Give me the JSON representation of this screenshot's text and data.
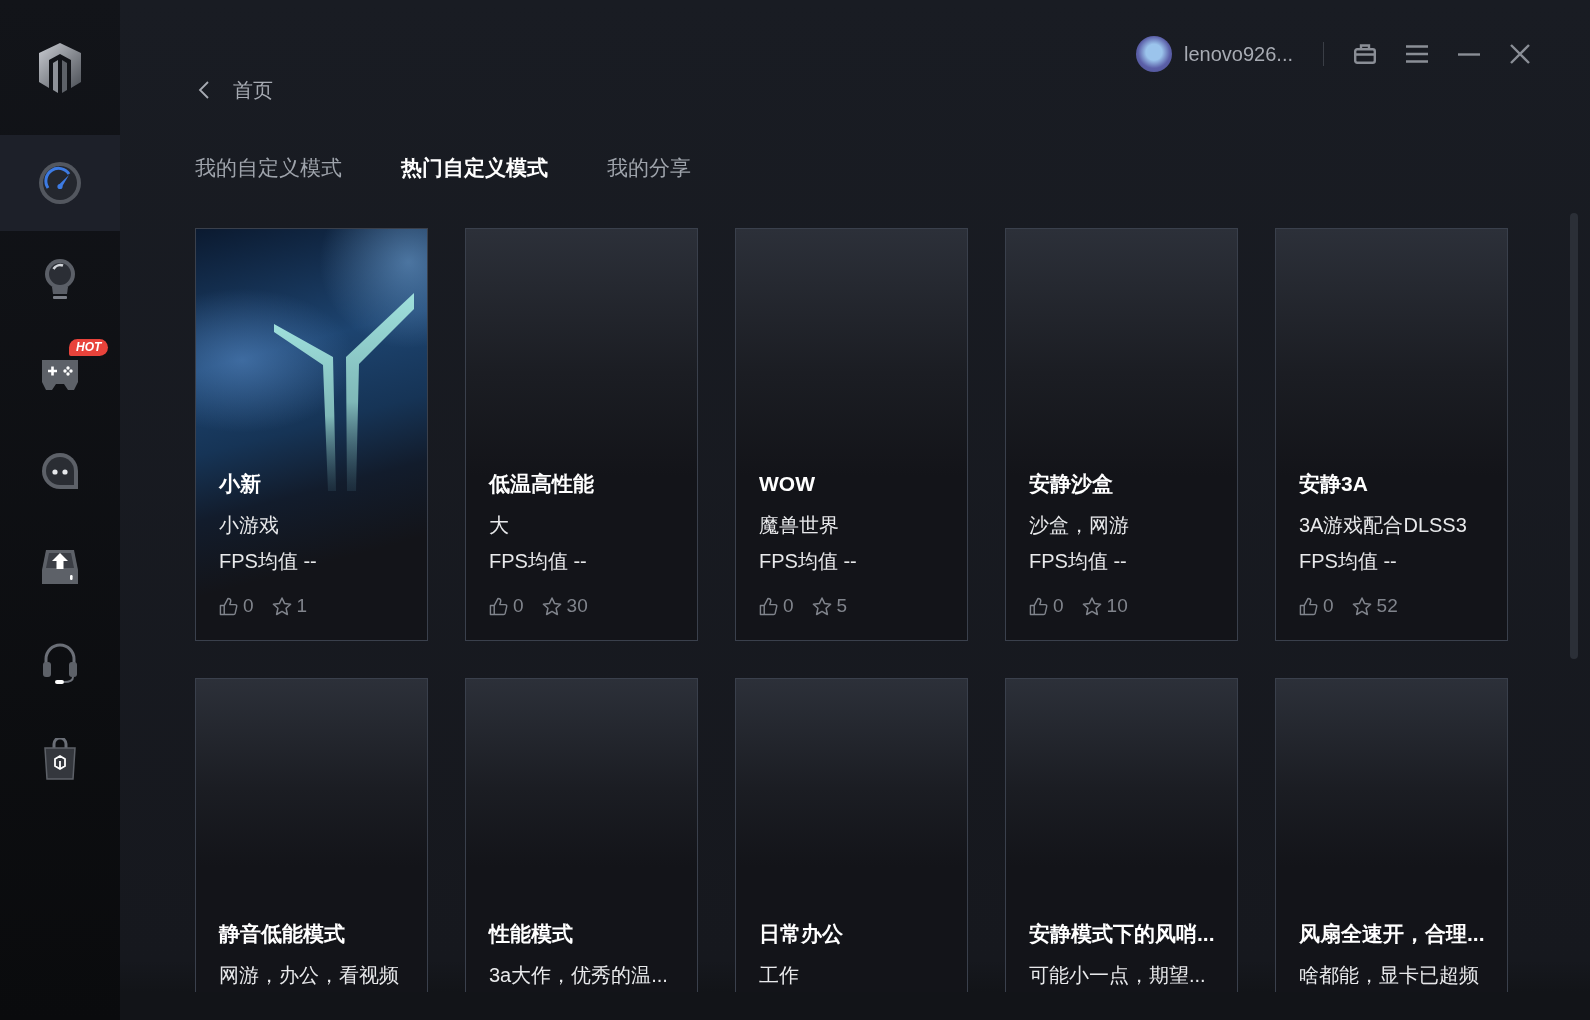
{
  "sidebar": {
    "items": [
      {
        "selected": true
      },
      {
        "selected": false
      },
      {
        "selected": false,
        "badge": "HOT"
      },
      {
        "selected": false
      },
      {
        "selected": false
      },
      {
        "selected": false
      },
      {
        "selected": false
      }
    ]
  },
  "user": {
    "name": "lenovo926..."
  },
  "back": {
    "label": "首页"
  },
  "tabs": [
    {
      "label": "我的自定义模式",
      "selected": false
    },
    {
      "label": "热门自定义模式",
      "selected": true
    },
    {
      "label": "我的分享",
      "selected": false
    }
  ],
  "cards": [
    {
      "kind": "artwork",
      "title": "小新",
      "description": "小游戏",
      "fps": "FPS均值 --",
      "likes": "0",
      "favorites": "1"
    },
    {
      "kind": "plain",
      "title": "低温高性能",
      "description": "大",
      "fps": "FPS均值 --",
      "likes": "0",
      "favorites": "30"
    },
    {
      "kind": "plain",
      "title": "WOW",
      "description": "魔兽世界",
      "fps": "FPS均值 --",
      "likes": "0",
      "favorites": "5"
    },
    {
      "kind": "plain",
      "title": "安静沙盒",
      "description": "沙盒，网游",
      "fps": "FPS均值 --",
      "likes": "0",
      "favorites": "10"
    },
    {
      "kind": "plain",
      "title": "安静3A",
      "description": "3A游戏配合DLSS3",
      "fps": "FPS均值 --",
      "likes": "0",
      "favorites": "52"
    },
    {
      "kind": "plain",
      "title": "静音低能模式",
      "description": "网游，办公，看视频"
    },
    {
      "kind": "plain",
      "title": "性能模式",
      "description": "3a大作，优秀的温..."
    },
    {
      "kind": "plain",
      "title": "日常办公",
      "description": "工作"
    },
    {
      "kind": "plain",
      "title": "安静模式下的风哨...",
      "description": "可能小一点，期望..."
    },
    {
      "kind": "plain",
      "title": "风扇全速开，合理...",
      "description": "啥都能，显卡已超频"
    }
  ]
}
